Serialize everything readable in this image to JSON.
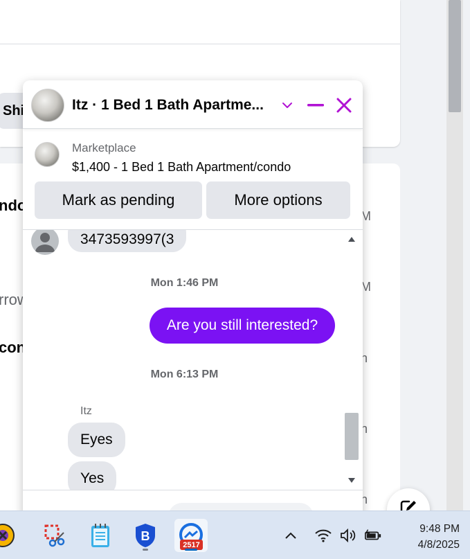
{
  "background": {
    "pill_label": "Shi",
    "line1": "ndo",
    "line2": "rrow",
    "line3": "con",
    "side_labels": [
      "M",
      "M",
      "n",
      "n",
      "n"
    ]
  },
  "chat": {
    "title": "Itz · 1 Bed 1 Bath Apartme...",
    "accent_color": "#b112d4",
    "listing": {
      "source": "Marketplace",
      "title": "$1,400 - 1 Bed 1 Bath Apartment/condo"
    },
    "actions": {
      "mark_pending": "Mark as pending",
      "more_options": "More options"
    },
    "messages": [
      {
        "text": "3473593997(3"
      },
      {
        "timestamp": "Mon 1:46 PM"
      },
      {
        "text": "Are you still interested?",
        "outgoing_color": "#7b12f3"
      },
      {
        "timestamp": "Mon 6:13 PM"
      },
      {
        "sender": "Itz"
      },
      {
        "text": "Eyes"
      },
      {
        "text": "Yes"
      }
    ]
  },
  "taskbar": {
    "apps": [
      {
        "icon": "game-controller-icon"
      },
      {
        "icon": "snipping-tool-icon"
      },
      {
        "icon": "notepad-icon"
      },
      {
        "icon": "bitdefender-icon"
      },
      {
        "icon": "messenger-icon",
        "badge": "2517"
      }
    ],
    "clock": {
      "time": "9:48 PM",
      "date": "4/8/2025"
    }
  }
}
